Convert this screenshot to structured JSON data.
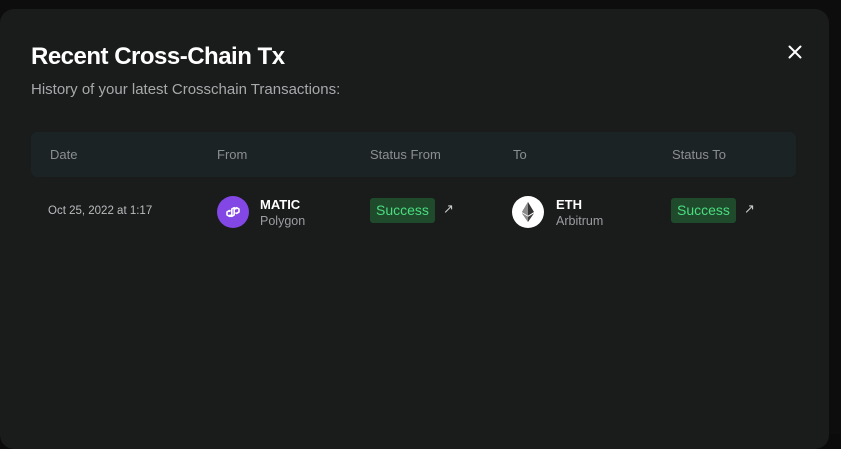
{
  "modal": {
    "title": "Recent Cross-Chain Tx",
    "subtitle": "History of your latest Crosschain Transactions:"
  },
  "table": {
    "columns": [
      "Date",
      "From",
      "Status From",
      "To",
      "Status To"
    ],
    "rows": [
      {
        "date": "Oct 25, 2022 at 1:17",
        "from": {
          "symbol": "MATIC",
          "chain": "Polygon",
          "icon": "polygon-icon"
        },
        "status_from": "Success",
        "to": {
          "symbol": "ETH",
          "chain": "Arbitrum",
          "icon": "ethereum-icon"
        },
        "status_to": "Success"
      }
    ]
  },
  "icons": {
    "close": "close-icon",
    "external_link": "external-link-icon",
    "external_link_glyph": "↗"
  },
  "colors": {
    "modal_bg": "#1a1b1b",
    "success_text": "#4ade80",
    "success_bg": "#1f4a2b",
    "polygon": "#8247e5"
  }
}
